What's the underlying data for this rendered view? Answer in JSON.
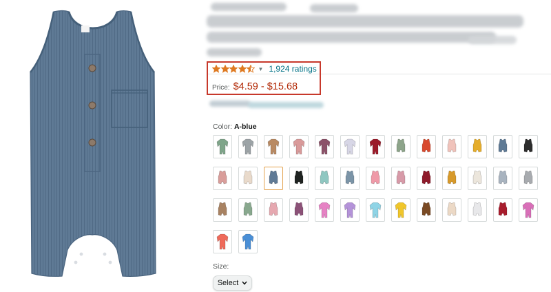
{
  "product": {
    "image_alt": "Blue ribbed sleeveless baby romper with button placket and chest pocket",
    "romper_color": "#5f7a95",
    "rating": {
      "stars": 4.5,
      "count_text": "1,924 ratings",
      "star_color": "#de7921"
    },
    "price": {
      "label": "Price:",
      "value": "$4.59 - $15.68",
      "color": "#b12704"
    },
    "color_option": {
      "label": "Color:",
      "selected": "A-blue"
    },
    "swatches": [
      {
        "color": "#7fa58a",
        "style": "sleeve"
      },
      {
        "color": "#9ca3a6",
        "style": "sleeve"
      },
      {
        "color": "#b98a63",
        "style": "sleeve"
      },
      {
        "color": "#d99a9a",
        "style": "sleeve"
      },
      {
        "color": "#8c5269",
        "style": "sleeve"
      },
      {
        "color": "#d7d6e6",
        "style": "sleeve"
      },
      {
        "color": "#9b1b2a",
        "style": "sleeve"
      },
      {
        "color": "#8da48a",
        "style": "tank"
      },
      {
        "color": "#d84a2f",
        "style": "tank"
      },
      {
        "color": "#f0c3bb",
        "style": "tank"
      },
      {
        "color": "#e5ad2b",
        "style": "tank"
      },
      {
        "color": "#5f7a95",
        "style": "tank"
      },
      {
        "color": "#2d2d2d",
        "style": "tank"
      },
      {
        "color": "#d99d9a",
        "style": "tank"
      },
      {
        "color": "#e9dacb",
        "style": "tank"
      },
      {
        "color": "#5f7a95",
        "style": "tank",
        "selected": true
      },
      {
        "color": "#1f2321",
        "style": "tank"
      },
      {
        "color": "#8fc7c1",
        "style": "tank"
      },
      {
        "color": "#7b94a7",
        "style": "tank"
      },
      {
        "color": "#ef9aa8",
        "style": "tank"
      },
      {
        "color": "#d79aa8",
        "style": "tank"
      },
      {
        "color": "#8e1a2a",
        "style": "tank"
      },
      {
        "color": "#d79a2b",
        "style": "tank"
      },
      {
        "color": "#ece6dc",
        "style": "tank"
      },
      {
        "color": "#a8b3bf",
        "style": "tank"
      },
      {
        "color": "#a8abaf",
        "style": "tank"
      },
      {
        "color": "#a88262",
        "style": "tank"
      },
      {
        "color": "#89a88e",
        "style": "tank"
      },
      {
        "color": "#e6a8b0",
        "style": "tank"
      },
      {
        "color": "#8c5278",
        "style": "tank"
      },
      {
        "color": "#e682c4",
        "style": "sleeve"
      },
      {
        "color": "#b493d9",
        "style": "sleeve"
      },
      {
        "color": "#8fd4e6",
        "style": "sleeve"
      },
      {
        "color": "#f0c62b",
        "style": "sleeve"
      },
      {
        "color": "#7a4a24",
        "style": "tank"
      },
      {
        "color": "#ecd9c6",
        "style": "tank"
      },
      {
        "color": "#e8e8ea",
        "style": "tank"
      },
      {
        "color": "#a81d2d",
        "style": "tank"
      },
      {
        "color": "#d96fb8",
        "style": "sleeve"
      },
      {
        "color": "#ef6a5a",
        "style": "sleeve"
      },
      {
        "color": "#4a8fd6",
        "style": "sleeve"
      }
    ],
    "size": {
      "label": "Size:",
      "select_label": "Select"
    }
  },
  "highlight_color": "#c7382b"
}
